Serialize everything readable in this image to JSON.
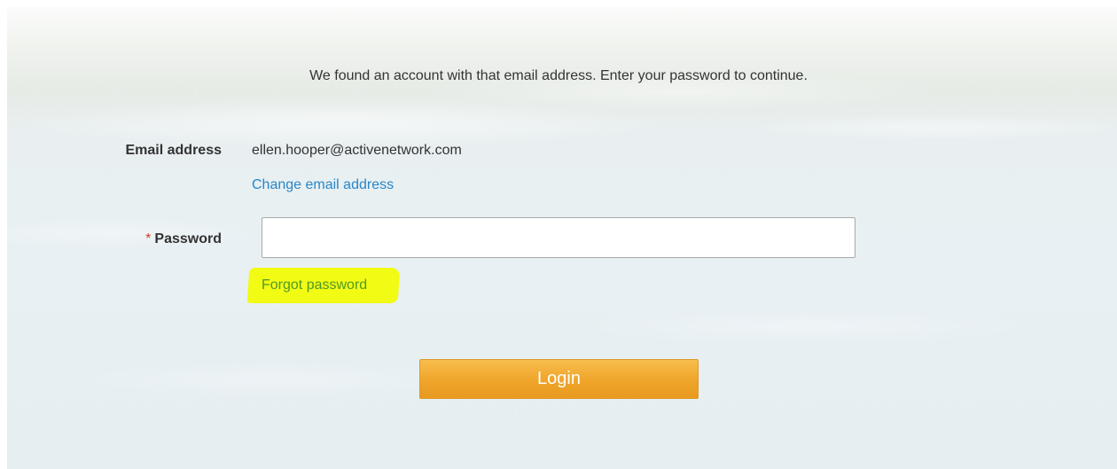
{
  "intro": {
    "message": "We found an account with that email address. Enter your password to continue."
  },
  "email": {
    "label": "Email address",
    "value": "ellen.hooper@activenetwork.com",
    "change_link": "Change email address"
  },
  "password": {
    "required_marker": "*",
    "label": "Password",
    "value": "",
    "placeholder": "",
    "forgot_link": "Forgot password"
  },
  "actions": {
    "login_label": "Login"
  },
  "colors": {
    "link_blue": "#2a86c8",
    "forgot_green": "#4c9a2a",
    "highlight_yellow": "#f2fb13",
    "login_orange": "#efa42a",
    "required_red": "#d0402a"
  }
}
